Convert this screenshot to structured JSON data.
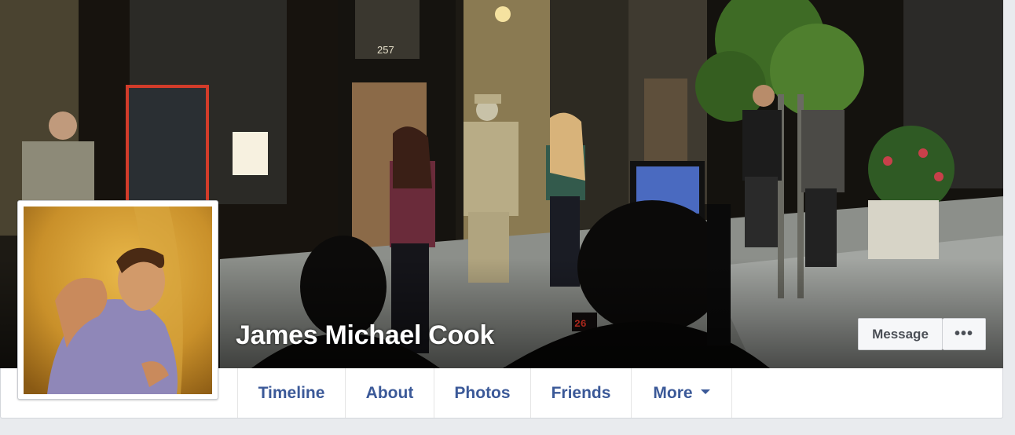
{
  "profile": {
    "name": "James Michael Cook"
  },
  "cover": {
    "address_number": "257",
    "monitor_readout": "26"
  },
  "actions": {
    "message_label": "Message",
    "more_label": "•••"
  },
  "nav": {
    "tabs": [
      {
        "label": "Timeline"
      },
      {
        "label": "About"
      },
      {
        "label": "Photos"
      },
      {
        "label": "Friends"
      },
      {
        "label": "More"
      }
    ]
  },
  "colors": {
    "link_blue": "#3b5998",
    "page_bg": "#e9ebee",
    "button_bg": "#f6f7f9"
  },
  "icons": {
    "more_caret": "caret-down-icon"
  }
}
